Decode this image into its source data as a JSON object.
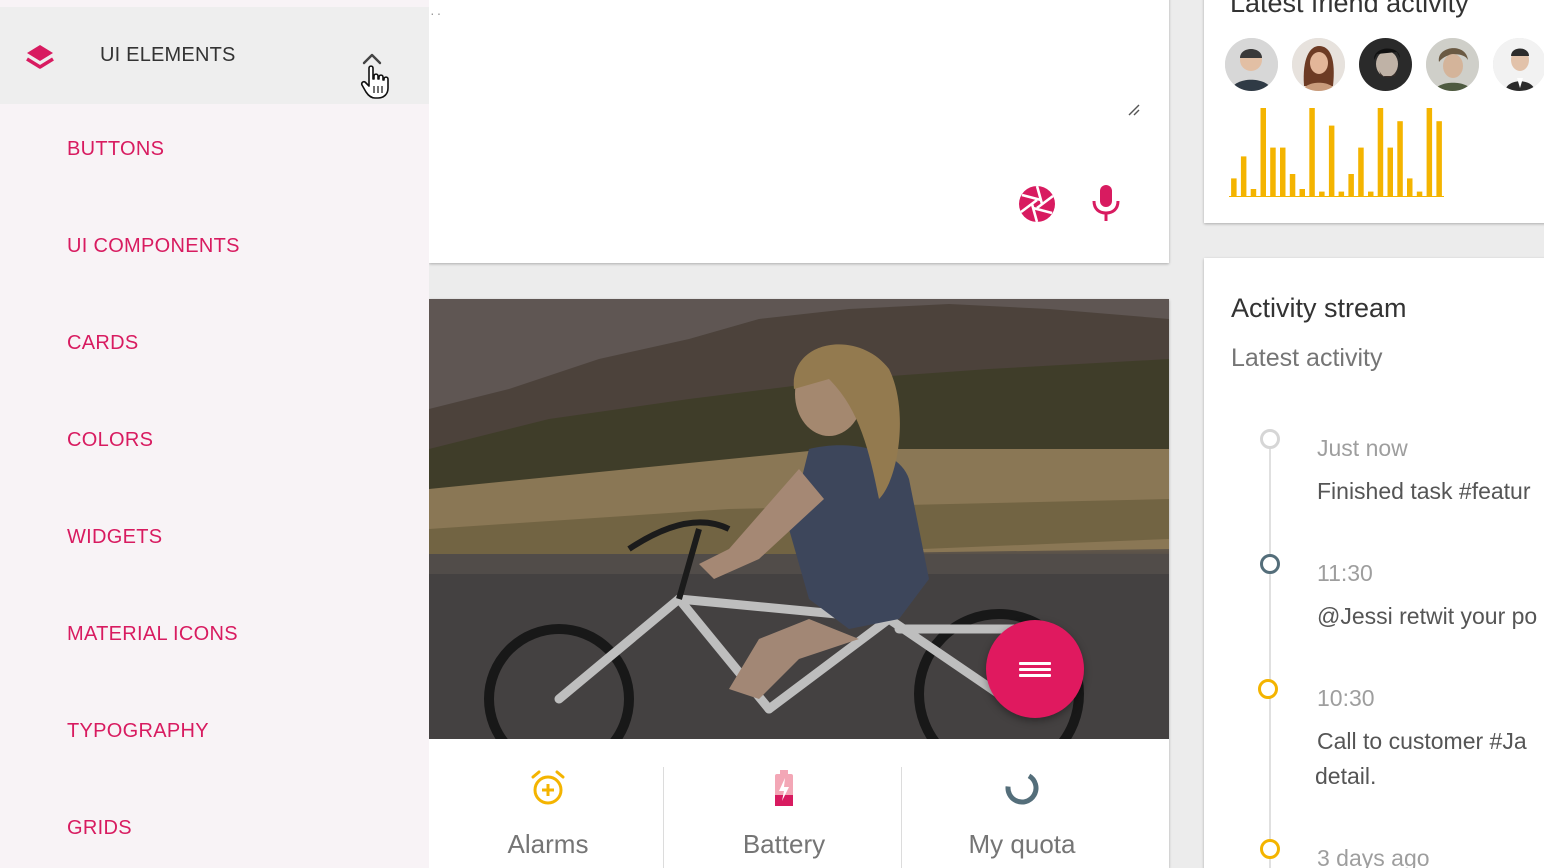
{
  "sidebar": {
    "header_title": "UI ELEMENTS",
    "items": [
      {
        "label": "BUTTONS"
      },
      {
        "label": "UI COMPONENTS"
      },
      {
        "label": "CARDS"
      },
      {
        "label": "COLORS"
      },
      {
        "label": "WIDGETS"
      },
      {
        "label": "MATERIAL ICONS"
      },
      {
        "label": "TYPOGRAPHY"
      },
      {
        "label": "GRIDS"
      }
    ]
  },
  "compose": {
    "dots": "··"
  },
  "stats": [
    {
      "label": "Alarms",
      "icon": "alarm-add-icon"
    },
    {
      "label": "Battery",
      "icon": "battery-charging-icon"
    },
    {
      "label": "My quota",
      "icon": "donut-progress-icon"
    }
  ],
  "friends": {
    "title": "Latest friend activity",
    "bars": [
      0.2,
      0.45,
      0.08,
      1.0,
      0.55,
      0.55,
      0.25,
      0.08,
      1.0,
      0.05,
      0.8,
      0.05,
      0.25,
      0.55,
      0.05,
      1.0,
      0.55,
      0.85,
      0.2,
      0.05,
      1.0,
      0.85
    ]
  },
  "activity": {
    "title": "Activity stream",
    "subtitle": "Latest activity",
    "items": [
      {
        "time": "Just now",
        "text": "Finished task #featur"
      },
      {
        "time": "11:30",
        "text": "@Jessi retwit your po"
      },
      {
        "time": "10:30",
        "text": "Call to customer #Ja",
        "text2": "detail."
      },
      {
        "time": "3 days ago"
      }
    ]
  },
  "colors": {
    "accent": "#d81b60",
    "fab": "#e0195f",
    "bar": "#f4b400",
    "dot_grey": "#cccccc",
    "dot_dark": "#546e7a",
    "dot_amber": "#f4b400"
  }
}
